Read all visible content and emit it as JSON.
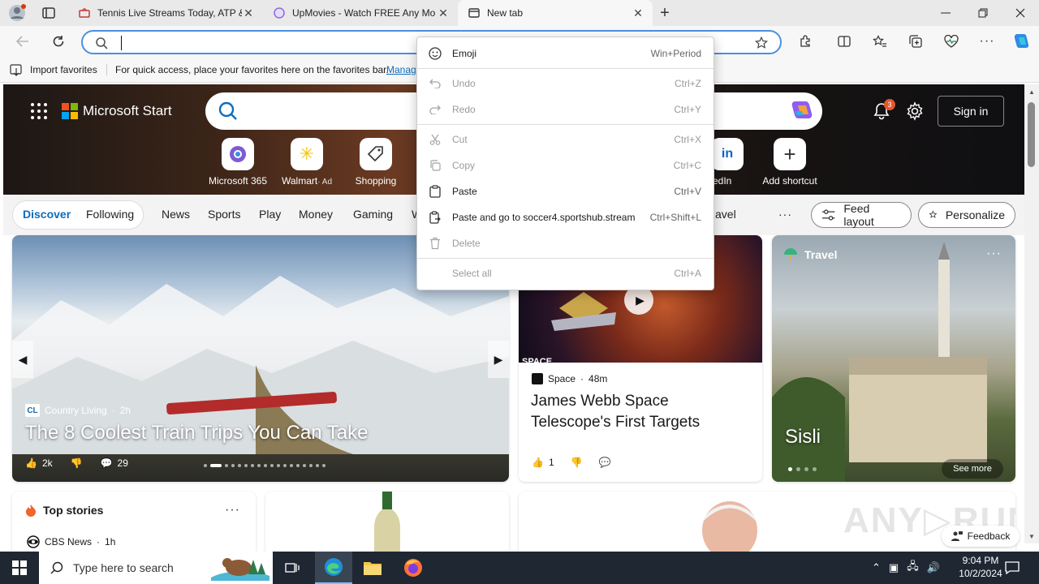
{
  "browser": {
    "tabs": [
      {
        "title": "Tennis Live Streams Today, ATP &",
        "icon": "sportshub-icon"
      },
      {
        "title": "UpMovies - Watch FREE Any Mo",
        "icon": "upmovies-icon"
      },
      {
        "title": "New tab",
        "icon": "newtab-icon"
      }
    ],
    "favorites_bar": {
      "import_label": "Import favorites",
      "hint": "For quick access, place your favorites here on the favorites bar.",
      "manage_link": "Manag"
    }
  },
  "context_menu": {
    "items": [
      {
        "label": "Emoji",
        "shortcut": "Win+Period",
        "icon": "smiley-icon",
        "enabled": true
      },
      {
        "label": "Undo",
        "shortcut": "Ctrl+Z",
        "icon": "undo-icon",
        "enabled": false
      },
      {
        "label": "Redo",
        "shortcut": "Ctrl+Y",
        "icon": "redo-icon",
        "enabled": false
      },
      {
        "label": "Cut",
        "shortcut": "Ctrl+X",
        "icon": "scissors-icon",
        "enabled": false
      },
      {
        "label": "Copy",
        "shortcut": "Ctrl+C",
        "icon": "copy-icon",
        "enabled": false
      },
      {
        "label": "Paste",
        "shortcut": "Ctrl+V",
        "icon": "clipboard-icon",
        "enabled": true
      },
      {
        "label": "Paste and go to soccer4.sportshub.stream",
        "shortcut": "Ctrl+Shift+L",
        "icon": "paste-go-icon",
        "enabled": true
      },
      {
        "label": "Delete",
        "shortcut": "",
        "icon": "trash-icon",
        "enabled": false
      },
      {
        "label": "Select all",
        "shortcut": "Ctrl+A",
        "icon": "",
        "enabled": false
      }
    ]
  },
  "msstart": {
    "brand": "Microsoft Start",
    "notifications_count": "3",
    "sign_in": "Sign in",
    "shortcuts": [
      {
        "label": "Microsoft 365"
      },
      {
        "label": "Walmart",
        "ad": "· Ad"
      },
      {
        "label": "Shopping"
      },
      {
        "label": "kedIn"
      },
      {
        "label": "Add shortcut"
      }
    ],
    "nav": {
      "discover": "Discover",
      "following": "Following",
      "items": [
        "News",
        "Sports",
        "Play",
        "Money",
        "Gaming",
        "W"
      ],
      "travel_partial": "avel",
      "feed_layout": "Feed layout",
      "personalize": "Personalize"
    },
    "hero_story": {
      "source_badge": "CL",
      "source": "Country Living",
      "age": "2h",
      "title": "The 8 Coolest Train Trips You Can Take",
      "likes": "2k",
      "comments": "29"
    },
    "space_story": {
      "tag": "SPACE",
      "source": "Space",
      "age": "48m",
      "title": "James Webb Space Telescope's First Targets",
      "likes": "1"
    },
    "travel_card": {
      "category": "Travel",
      "place": "Sisli",
      "see_more": "See more"
    },
    "top_stories": {
      "title": "Top stories",
      "first_source": "CBS News",
      "first_age": "1h"
    },
    "feedback": "Feedback"
  },
  "taskbar": {
    "search_placeholder": "Type here to search",
    "time": "9:04 PM",
    "date": "10/2/2024"
  },
  "colors": {
    "accent": "#0f6cbd",
    "omnibox_focus": "#4a90e2",
    "taskbar": "#1f2733",
    "notification_badge": "#e4572e"
  }
}
